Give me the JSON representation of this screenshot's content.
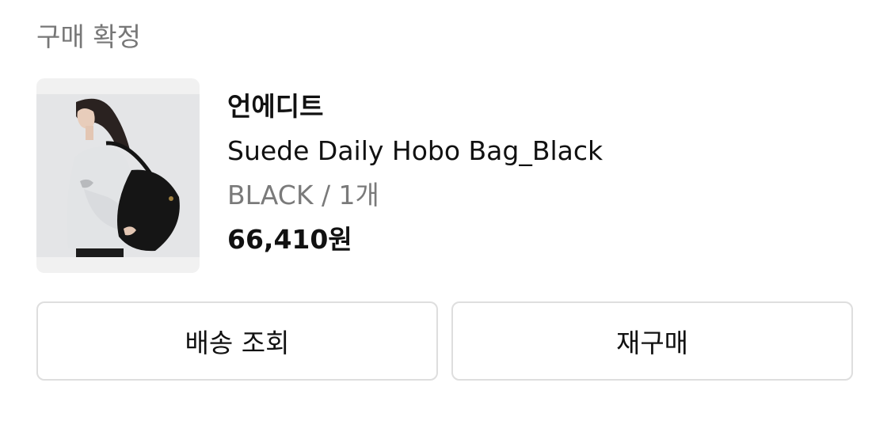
{
  "order": {
    "status_label": "구매 확정"
  },
  "product": {
    "image_icon": "product-photo-bag",
    "brand": "언에디트",
    "name": "Suede Daily Hobo Bag_Black",
    "option": "BLACK / 1개",
    "price": "66,410원"
  },
  "actions": {
    "track_delivery_label": "배송 조회",
    "repurchase_label": "재구매"
  },
  "colors": {
    "status_text": "#777777",
    "primary_text": "#111111",
    "secondary_text": "#7a7a7a",
    "button_border": "#dedede",
    "thumb_bg": "#f1f1f1"
  }
}
